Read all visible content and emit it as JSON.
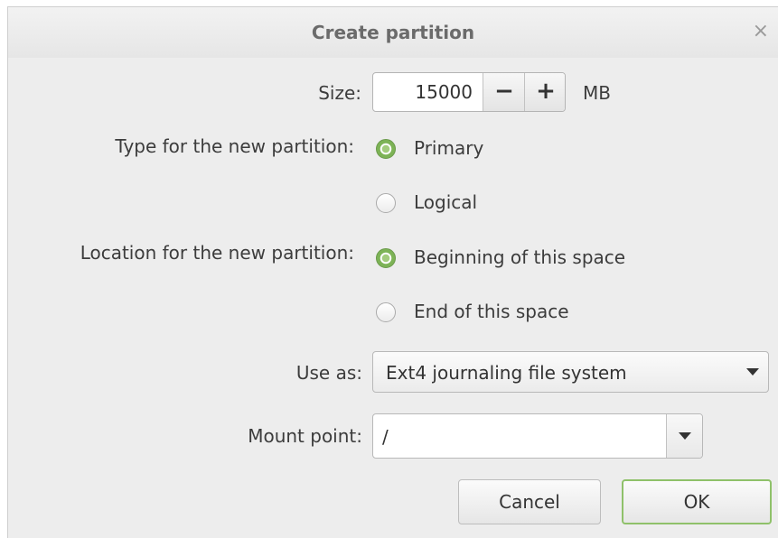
{
  "dialog": {
    "title": "Create partition",
    "close_glyph": "×"
  },
  "size": {
    "label": "Size:",
    "value": "15000",
    "minus_glyph": "−",
    "plus_glyph": "+",
    "unit": "MB"
  },
  "type": {
    "label": "Type for the new partition:",
    "options": [
      {
        "label": "Primary",
        "checked": true
      },
      {
        "label": "Logical",
        "checked": false
      }
    ]
  },
  "location": {
    "label": "Location for the new partition:",
    "options": [
      {
        "label": "Beginning of this space",
        "checked": true
      },
      {
        "label": "End of this space",
        "checked": false
      }
    ]
  },
  "use_as": {
    "label": "Use as:",
    "selected": "Ext4 journaling file system"
  },
  "mount_point": {
    "label": "Mount point:",
    "value": "/"
  },
  "buttons": {
    "cancel": "Cancel",
    "ok": "OK"
  },
  "colors": {
    "accent": "#7db356",
    "dialog_bg": "#ededed"
  }
}
